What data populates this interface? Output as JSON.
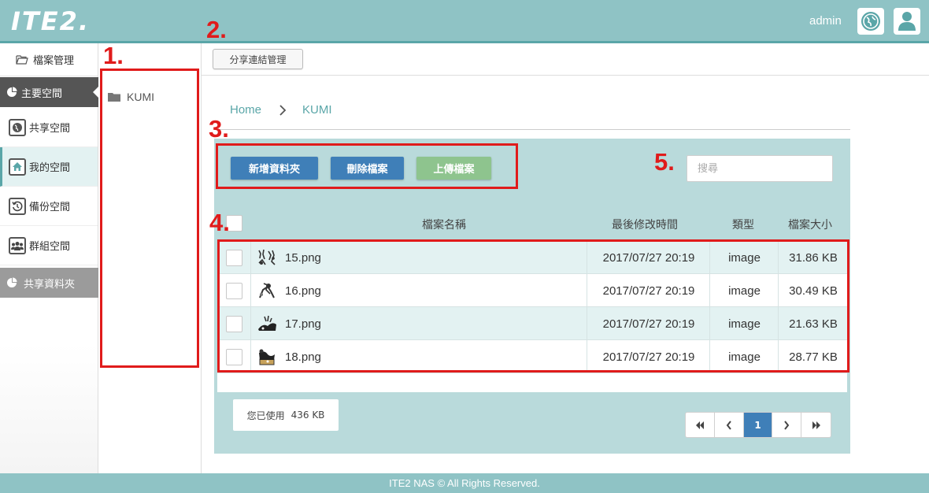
{
  "header": {
    "logo": "ITE2.",
    "username": "admin",
    "globe_icon": "globe-icon",
    "user_icon": "user-icon",
    "brand_color": "#8fc3c5"
  },
  "sidebar": {
    "file_manage_label": "檔案管理",
    "main_space_header": "主要空間",
    "items": [
      {
        "label": "共享空間",
        "icon": "globe-icon"
      },
      {
        "label": "我的空間",
        "icon": "home-icon"
      },
      {
        "label": "備份空間",
        "icon": "history-icon"
      },
      {
        "label": "群組空間",
        "icon": "group-icon"
      }
    ],
    "shared_folder_header": "共享資料夾"
  },
  "tree": {
    "folder": "KUMI"
  },
  "toolbar": {
    "share_link_label": "分享連結管理"
  },
  "breadcrumb": {
    "home": "Home",
    "current": "KUMI"
  },
  "actions": {
    "new_folder": "新增資料夾",
    "delete_file": "刪除檔案",
    "upload_file": "上傳檔案",
    "primary_color": "#3f7fb8",
    "upload_color": "#8ec48e"
  },
  "search": {
    "placeholder": "搜尋"
  },
  "table": {
    "columns": {
      "name": "檔案名稱",
      "modified": "最後修改時間",
      "type": "類型",
      "size": "檔案大小"
    },
    "rows": [
      {
        "name": "15.png",
        "modified": "2017/07/27 20:19",
        "type": "image",
        "size": "31.86 KB"
      },
      {
        "name": "16.png",
        "modified": "2017/07/27 20:19",
        "type": "image",
        "size": "30.49 KB"
      },
      {
        "name": "17.png",
        "modified": "2017/07/27 20:19",
        "type": "image",
        "size": "21.63 KB"
      },
      {
        "name": "18.png",
        "modified": "2017/07/27 20:19",
        "type": "image",
        "size": "28.77 KB"
      }
    ]
  },
  "usage": {
    "label": "您已使用",
    "value": "436 KB"
  },
  "pagination": {
    "current_page": "1"
  },
  "footer": {
    "text": "ITE2 NAS © All Rights Reserved."
  },
  "annotations": [
    "1.",
    "2.",
    "3.",
    "4.",
    "5."
  ],
  "annotation_color": "#e01b1b"
}
